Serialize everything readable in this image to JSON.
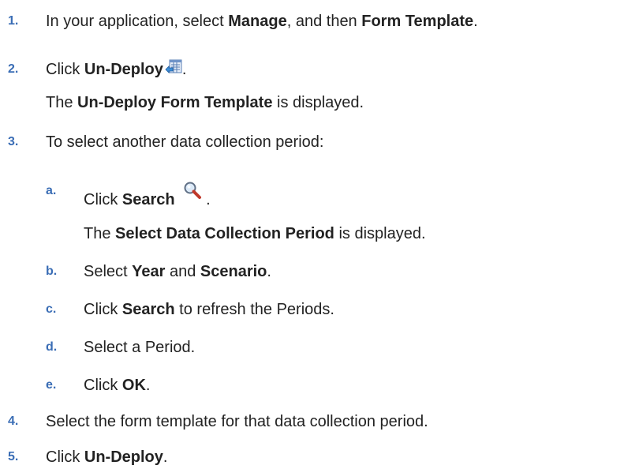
{
  "steps": [
    {
      "number": "1.",
      "parts": {
        "a": "In your application, select ",
        "b": "Manage",
        "c": ", and then ",
        "d": "Form Template",
        "e": "."
      }
    },
    {
      "number": "2.",
      "parts": {
        "a": "Click ",
        "b": "Un-Deploy",
        "c": "."
      },
      "icon": "undeploy-form-icon",
      "result": {
        "a": "The ",
        "b": "Un-Deploy Form Template",
        "c": " is displayed."
      }
    },
    {
      "number": "3.",
      "parts": {
        "a": "To select another data collection period:"
      },
      "substeps": [
        {
          "letter": "a.",
          "parts": {
            "a": "Click ",
            "b": "Search",
            "c": " ."
          },
          "icon": "search-icon",
          "result": {
            "a": "The ",
            "b": "Select Data Collection Period",
            "c": " is displayed."
          }
        },
        {
          "letter": "b.",
          "parts": {
            "a": "Select ",
            "b": "Year",
            "c": " and ",
            "d": "Scenario",
            "e": "."
          }
        },
        {
          "letter": "c.",
          "parts": {
            "a": "Click ",
            "b": "Search",
            "c": " to refresh the Periods."
          }
        },
        {
          "letter": "d.",
          "parts": {
            "a": "Select a Period."
          }
        },
        {
          "letter": "e.",
          "parts": {
            "a": "Click ",
            "b": "OK",
            "c": "."
          }
        }
      ]
    },
    {
      "number": "4.",
      "parts": {
        "a": "Select the form template for that data collection period."
      }
    },
    {
      "number": "5.",
      "parts": {
        "a": "Click ",
        "b": "Un-Deploy",
        "c": "."
      }
    }
  ],
  "colors": {
    "step_number": "#3a6db5",
    "text": "#222222"
  }
}
